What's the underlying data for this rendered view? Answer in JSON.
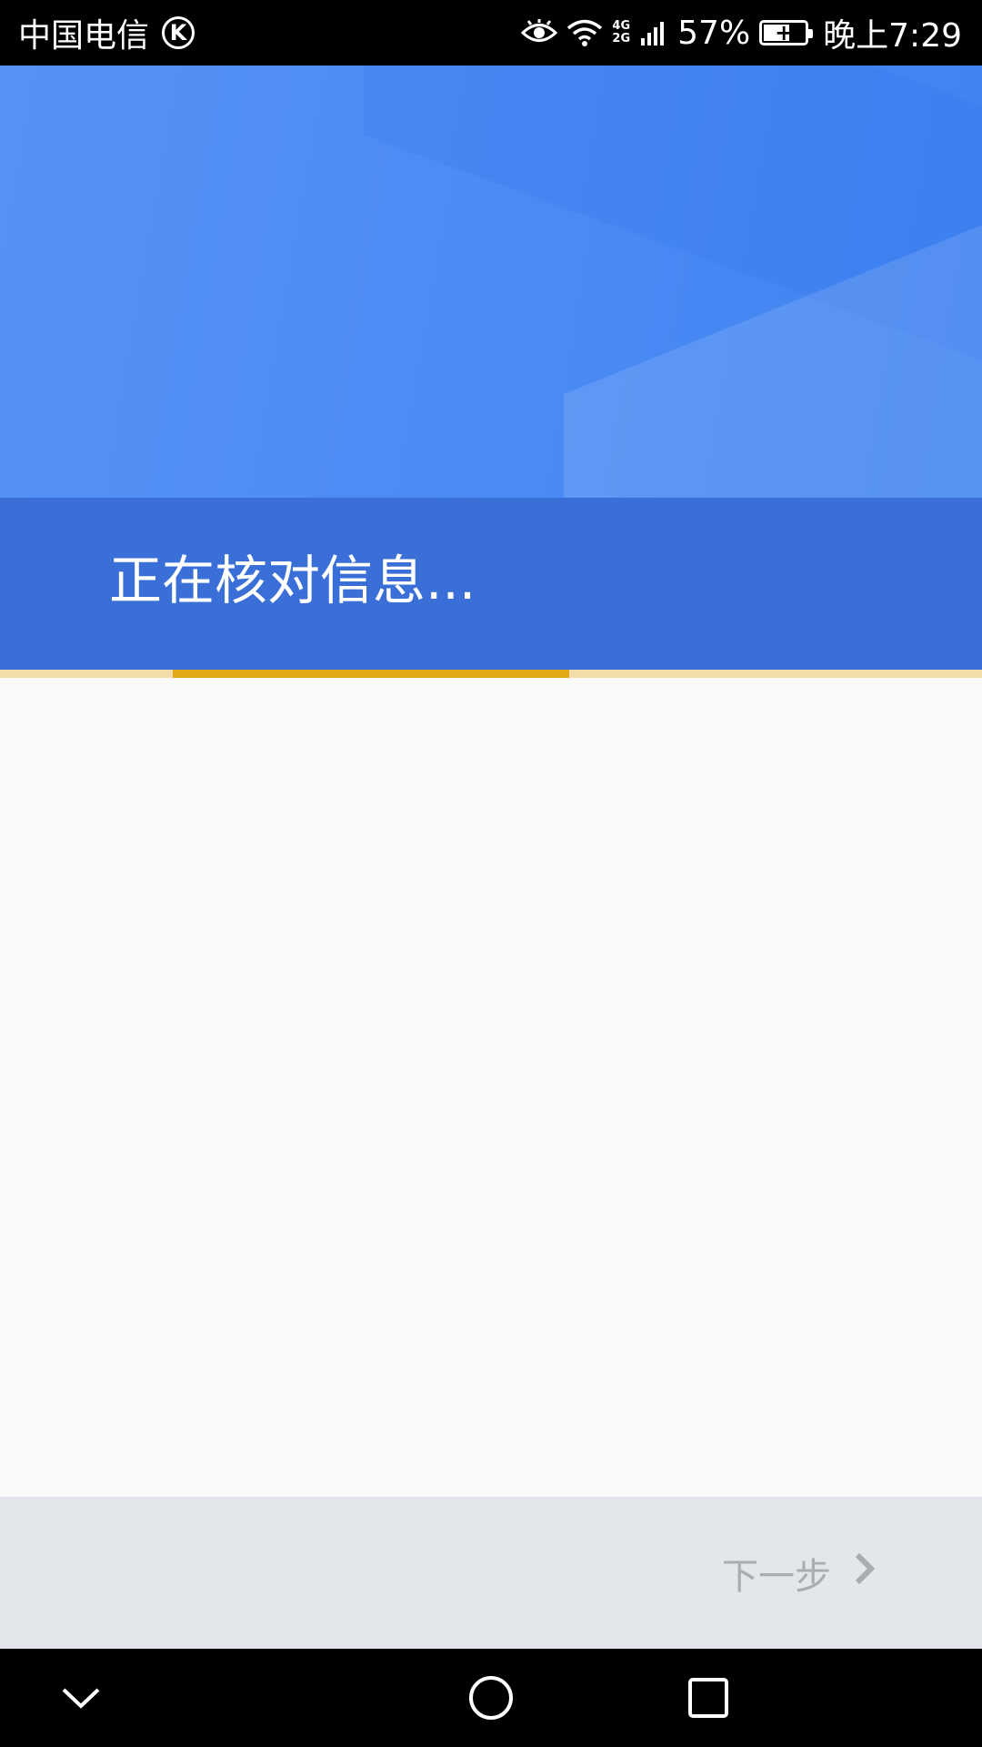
{
  "status_bar": {
    "carrier": "中国电信",
    "carrier_badge": "K",
    "network_top": "4G",
    "network_bottom": "2G",
    "battery": "57%",
    "battery_level": 0.57,
    "time": "晚上7:29",
    "icons": [
      "eye-comfort-icon",
      "wifi-icon",
      "cell-signal-icon",
      "battery-charging-icon"
    ]
  },
  "header": {
    "title": "正在核对信息..."
  },
  "progress": {
    "type": "indeterminate"
  },
  "footer": {
    "next_label": "下一步",
    "next_icon": "chevron-right-icon"
  },
  "nav_bar": {
    "icons": [
      "nav-back-icon",
      "nav-home-icon",
      "nav-recents-icon"
    ]
  },
  "colors": {
    "header_blue": "#4a8af4",
    "title_band": "#3a6fd8",
    "progress": "#e3a816",
    "footer_bg": "#e3e7eb",
    "disabled_text": "#a9acb0"
  }
}
